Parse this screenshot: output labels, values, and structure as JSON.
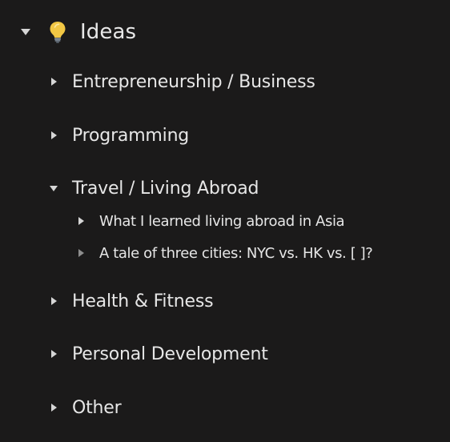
{
  "header": {
    "title": "Ideas",
    "icon": "lightbulb-icon",
    "expanded": true
  },
  "items": [
    {
      "label": "Entrepreneurship / Business",
      "expanded": false
    },
    {
      "label": "Programming",
      "expanded": false
    },
    {
      "label": "Travel / Living Abroad",
      "expanded": true,
      "children": [
        {
          "label": "What I learned living abroad in Asia",
          "expanded": false
        },
        {
          "label": "A tale of three cities: NYC vs. HK vs. [  ]?",
          "expanded": false
        }
      ]
    },
    {
      "label": "Health & Fitness",
      "expanded": false
    },
    {
      "label": "Personal Development",
      "expanded": false
    },
    {
      "label": "Other",
      "expanded": false
    }
  ],
  "colors": {
    "background": "#1b1a1a",
    "text": "#e6e6e6",
    "toggle": "#d6d6d6",
    "toggle_dim": "#8d8d8d",
    "bulb": "#f2c744"
  }
}
